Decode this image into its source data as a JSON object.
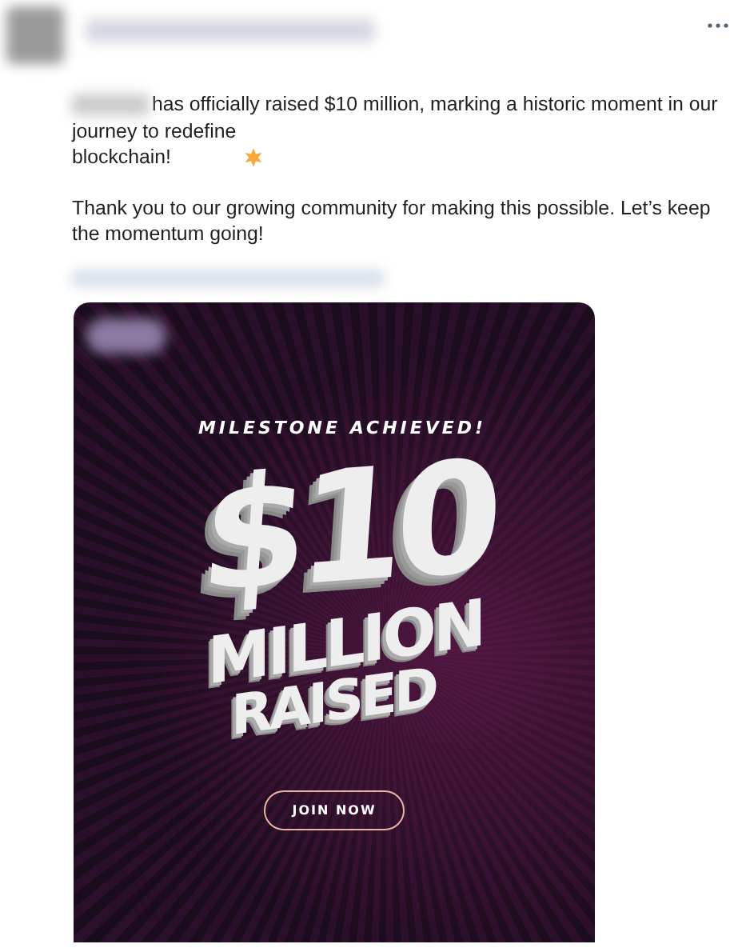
{
  "post": {
    "lead": "has officially raised $10 million, marking a historic moment in our",
    "paragraphs": [
      "journey to redefine\nblockchain!",
      "Thank you to our growing community for making this possible. Let’s keep\nthe momentum going!"
    ]
  },
  "media": {
    "headline": "MILESTONE ACHIEVED!",
    "amount": "$10",
    "lines": [
      "MILLION",
      "RAISED"
    ],
    "button": "JOIN NOW"
  }
}
